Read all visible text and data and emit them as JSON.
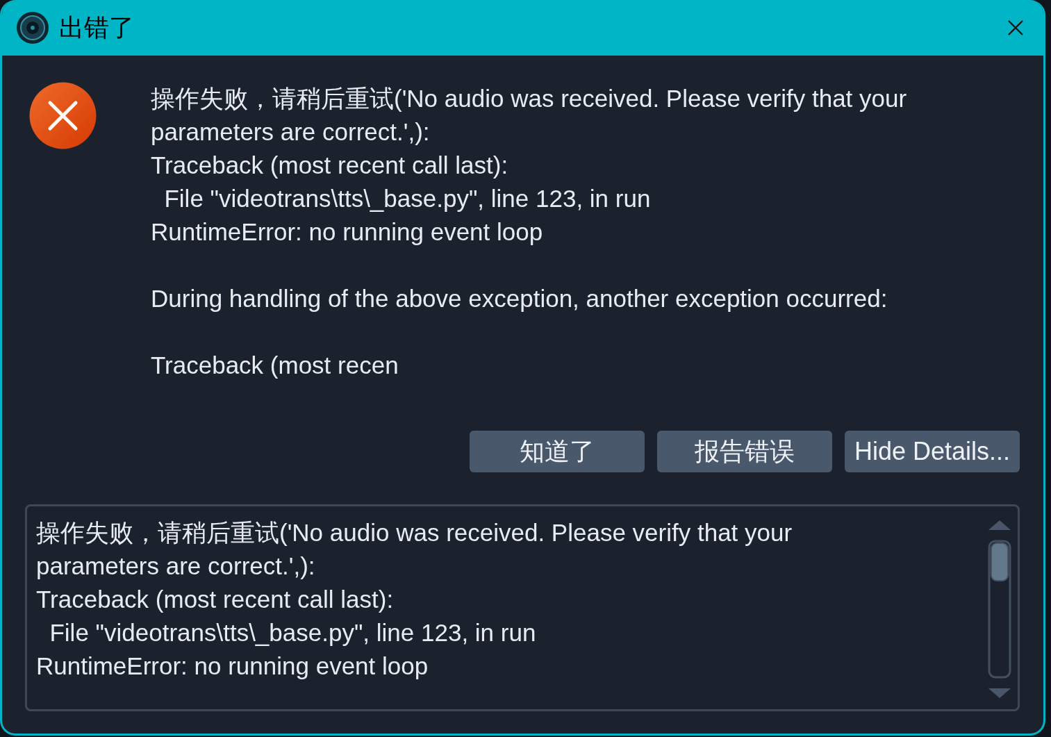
{
  "window": {
    "title": "出错了"
  },
  "message": {
    "paragraphs": [
      [
        "操作失败，请稍后重试('No audio was received. Please verify that your",
        "parameters are correct.',):",
        "Traceback (most recent call last):",
        "  File \"videotrans\\tts\\_base.py\", line 123, in run",
        "RuntimeError: no running event loop"
      ],
      [
        "During handling of the above exception, another exception occurred:"
      ],
      [
        "Traceback (most recen"
      ]
    ]
  },
  "buttons": [
    {
      "label": "知道了"
    },
    {
      "label": "报告错误"
    },
    {
      "label": "Hide Details..."
    }
  ],
  "details": {
    "lines": [
      "操作失败，请稍后重试('No audio was received. Please verify that your",
      "parameters are correct.',):",
      "Traceback (most recent call last):",
      "  File \"videotrans\\tts\\_base.py\", line 123, in run",
      "RuntimeError: no running event loop"
    ]
  }
}
